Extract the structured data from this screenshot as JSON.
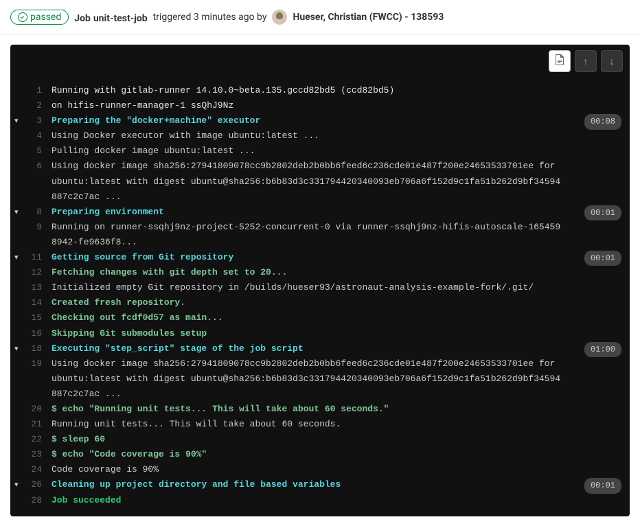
{
  "header": {
    "status": "passed",
    "job_prefix": "Job",
    "job_name": "unit-test-job",
    "triggered_text": "triggered 3 minutes ago by",
    "user_name": "Hueser, Christian (FWCC) - 138593"
  },
  "toolbar": {
    "raw_icon": "📄",
    "scroll_top_icon": "↑",
    "scroll_bottom_icon": "↓"
  },
  "log": [
    {
      "n": 1,
      "cls": "white",
      "text": "Running with gitlab-runner 14.10.0~beta.135.gccd82bd5 (ccd82bd5)"
    },
    {
      "n": 2,
      "cls": "white",
      "text": "  on hifis-runner-manager-1 ssQhJ9Nz"
    },
    {
      "n": 3,
      "cls": "cyan",
      "text": "Preparing the \"docker+machine\" executor",
      "chev": true,
      "dur": "00:08"
    },
    {
      "n": 4,
      "cls": "plain",
      "text": "Using Docker executor with image ubuntu:latest ..."
    },
    {
      "n": 5,
      "cls": "plain",
      "text": "Pulling docker image ubuntu:latest ..."
    },
    {
      "n": 6,
      "cls": "plain",
      "text": "Using docker image sha256:27941809078cc9b2802deb2b0bb6feed6c236cde01e487f200e24653533701ee for ubuntu:latest with digest ubuntu@sha256:b6b83d3c331794420340093eb706a6f152d9c1fa51b262d9bf34594887c2c7ac ..."
    },
    {
      "n": 8,
      "cls": "cyan",
      "text": "Preparing environment",
      "chev": true,
      "dur": "00:01"
    },
    {
      "n": 9,
      "cls": "plain",
      "text": "Running on runner-ssqhj9nz-project-5252-concurrent-0 via runner-ssqhj9nz-hifis-autoscale-1654598942-fe9636f8..."
    },
    {
      "n": 11,
      "cls": "cyan",
      "text": "Getting source from Git repository",
      "chev": true,
      "dur": "00:01"
    },
    {
      "n": 12,
      "cls": "green",
      "text": "Fetching changes with git depth set to 20..."
    },
    {
      "n": 13,
      "cls": "plain",
      "text": "Initialized empty Git repository in /builds/hueser93/astronaut-analysis-example-fork/.git/"
    },
    {
      "n": 14,
      "cls": "green",
      "text": "Created fresh repository."
    },
    {
      "n": 15,
      "cls": "green",
      "text": "Checking out fcdf0d57 as main..."
    },
    {
      "n": 16,
      "cls": "green",
      "text": "Skipping Git submodules setup"
    },
    {
      "n": 18,
      "cls": "cyan",
      "text": "Executing \"step_script\" stage of the job script",
      "chev": true,
      "dur": "01:00"
    },
    {
      "n": 19,
      "cls": "plain",
      "text": "Using docker image sha256:27941809078cc9b2802deb2b0bb6feed6c236cde01e487f200e24653533701ee for ubuntu:latest with digest ubuntu@sha256:b6b83d3c331794420340093eb706a6f152d9c1fa51b262d9bf34594887c2c7ac ..."
    },
    {
      "n": 20,
      "cls": "green",
      "text": "$ echo \"Running unit tests... This will take about 60 seconds.\""
    },
    {
      "n": 21,
      "cls": "plain",
      "text": "Running unit tests... This will take about 60 seconds."
    },
    {
      "n": 22,
      "cls": "green",
      "text": "$ sleep 60"
    },
    {
      "n": 23,
      "cls": "green",
      "text": "$ echo \"Code coverage is 90%\""
    },
    {
      "n": 24,
      "cls": "plain",
      "text": "Code coverage is 90%"
    },
    {
      "n": 26,
      "cls": "cyan",
      "text": "Cleaning up project directory and file based variables",
      "chev": true,
      "dur": "00:01"
    },
    {
      "n": 28,
      "cls": "green-bright",
      "text": "Job succeeded"
    }
  ]
}
